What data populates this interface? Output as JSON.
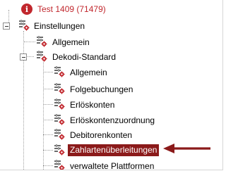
{
  "tree": {
    "root": {
      "label": "Test 1409 (71479)",
      "icon": "info-icon"
    },
    "einstellungen": {
      "label": "Einstellungen",
      "icon": "settings-node-icon"
    },
    "allgemein": {
      "label": "Allgemein",
      "icon": "settings-node-icon"
    },
    "dekodi": {
      "label": "Dekodi-Standard",
      "icon": "settings-node-icon"
    },
    "children": [
      {
        "label": "Allgemein",
        "icon": "settings-node-icon"
      },
      {
        "label": "Folgebuchungen",
        "icon": "settings-node-icon"
      },
      {
        "label": "Erlöskonten",
        "icon": "settings-node-icon"
      },
      {
        "label": "Erlöskontenzuordnung",
        "icon": "settings-node-icon"
      },
      {
        "label": "Debitorenkonten",
        "icon": "settings-node-icon"
      },
      {
        "label": "Zahlartenüberleitungen",
        "icon": "settings-node-icon",
        "selected": true
      },
      {
        "label": "verwaltete Plattformen",
        "icon": "settings-node-icon"
      }
    ]
  },
  "colors": {
    "selection": "#8b1a1a",
    "arrow": "#8b1a1a",
    "root_text": "#c1272d"
  }
}
